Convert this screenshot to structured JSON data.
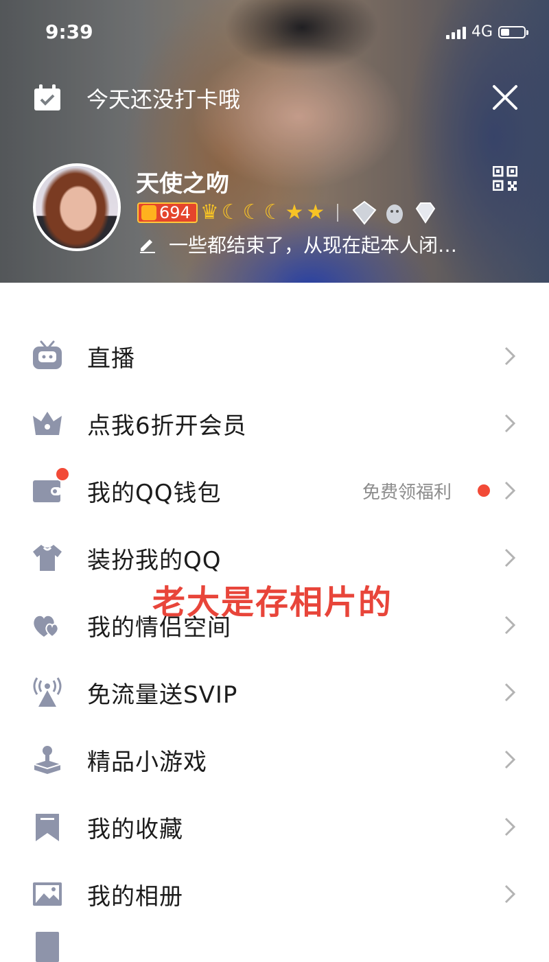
{
  "status_bar": {
    "time": "9:39",
    "network": "4G"
  },
  "header": {
    "checkin_text": "今天还没打卡哦",
    "nickname": "天使之吻",
    "level": "694",
    "signature": "一些都结束了，从现在起本人闭…",
    "badges": [
      "crown",
      "moon",
      "moon",
      "moon",
      "star",
      "star"
    ]
  },
  "menu": {
    "items": [
      {
        "label": "直播",
        "icon": "live-tv-icon"
      },
      {
        "label": "点我6折开会员",
        "icon": "vip-crown-icon"
      },
      {
        "label": "我的QQ钱包",
        "icon": "wallet-icon",
        "hint": "免费领福利"
      },
      {
        "label": "装扮我的QQ",
        "icon": "shirt-icon"
      },
      {
        "label": "我的情侣空间",
        "icon": "hearts-icon"
      },
      {
        "label": "免流量送SVIP",
        "icon": "broadcast-icon"
      },
      {
        "label": "精品小游戏",
        "icon": "joystick-icon"
      },
      {
        "label": "我的收藏",
        "icon": "bookmark-icon"
      },
      {
        "label": "我的相册",
        "icon": "photo-icon"
      }
    ]
  },
  "watermark": "老大是存相片的",
  "colors": {
    "icon": "#8e94aa",
    "accent_red": "#f24a37",
    "chevron": "#b3b3b3"
  }
}
